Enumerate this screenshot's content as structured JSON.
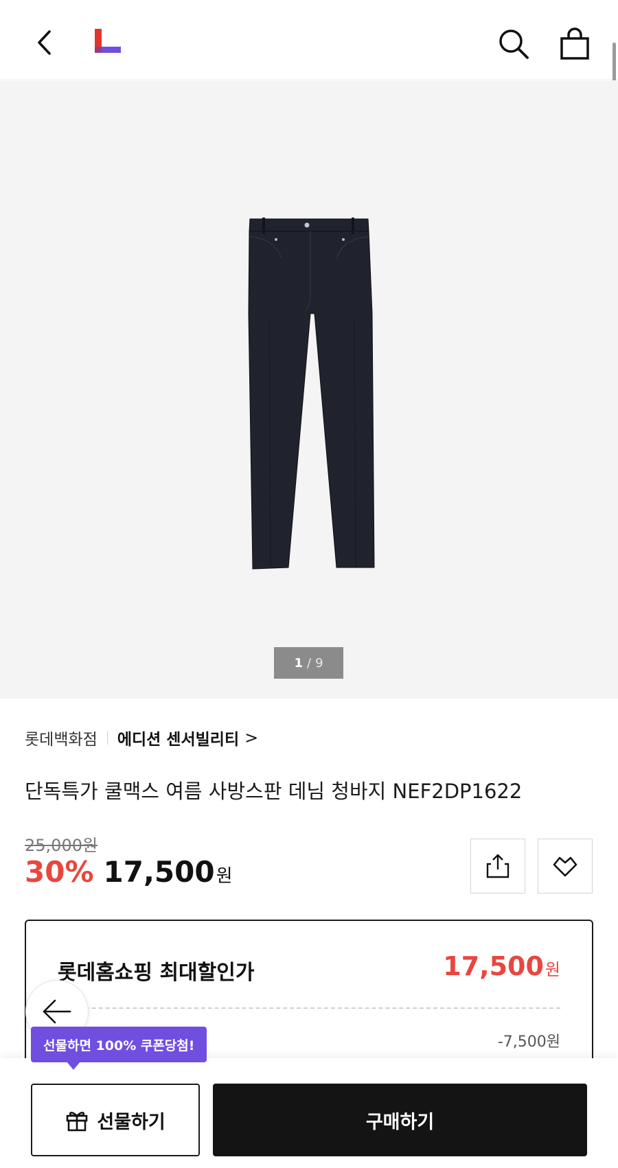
{
  "header": {
    "back_icon": "chevron-left-icon",
    "logo_icon": "lotte-l-logo",
    "search_icon": "search-icon",
    "bag_icon": "shopping-bag-icon",
    "logo_colors": {
      "red": "#e1362d",
      "purple": "#6f4ee0"
    }
  },
  "gallery": {
    "current": "1",
    "separator": "/",
    "total": "9"
  },
  "product": {
    "store": "롯데백화점",
    "brand": "에디션 센서빌리티",
    "brand_chevron": ">",
    "title": "단독특가 쿨맥스 여름 사방스판 데님 청바지 NEF2DP1622",
    "original_price": "25,000원",
    "discount_rate": "30%",
    "price": "17,500",
    "price_unit": "원",
    "accent_color": "#e8473f"
  },
  "actions": {
    "share_icon": "share-icon",
    "like_icon": "heart-icon"
  },
  "discount_box": {
    "title": "롯데홈쇼핑 최대할인가",
    "price": "17,500",
    "price_unit": "원",
    "discount_amount": "-7,500원"
  },
  "floating": {
    "back_icon": "arrow-left-icon"
  },
  "bottom_bar": {
    "gift_tooltip": "선물하면 100% 쿠폰당첨!",
    "gift_label": "선물하기",
    "gift_icon": "gift-icon",
    "buy_label": "구매하기",
    "tooltip_color": "#6f4ee0"
  }
}
